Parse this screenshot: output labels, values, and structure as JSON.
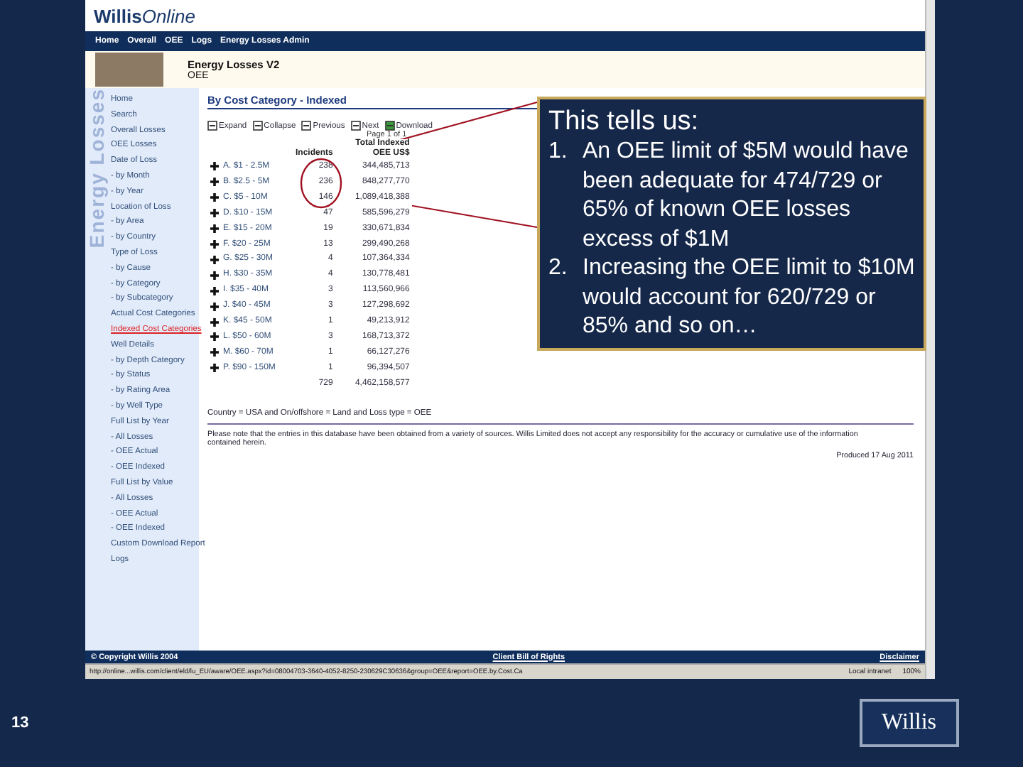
{
  "browser": {
    "logo": {
      "brand": "Willis",
      "suffix": "Online"
    },
    "nav": [
      "Home",
      "Overall",
      "OEE",
      "Logs",
      "Energy Losses Admin"
    ],
    "banner": {
      "title": "Energy Losses V2",
      "subtitle": "OEE"
    },
    "sidebar": {
      "watermark": "Energy Losses",
      "items": [
        {
          "label": "Home",
          "selected": false
        },
        {
          "label": "Search",
          "selected": false
        },
        {
          "label": "Overall Losses",
          "selected": false
        },
        {
          "label": "OEE Losses",
          "selected": false
        },
        {
          "label": "Date of Loss",
          "selected": false
        },
        {
          "label": "- by Month",
          "selected": false
        },
        {
          "label": "- by Year",
          "selected": false
        },
        {
          "label": "Location of Loss",
          "selected": false
        },
        {
          "label": "- by Area",
          "selected": false
        },
        {
          "label": "- by Country",
          "selected": false
        },
        {
          "label": "Type of Loss",
          "selected": false
        },
        {
          "label": "- by Cause",
          "selected": false
        },
        {
          "label": "- by Category",
          "selected": false
        },
        {
          "label": "- by Subcategory",
          "selected": false
        },
        {
          "label": "Actual Cost Categories",
          "selected": false
        },
        {
          "label": "Indexed Cost Categories",
          "selected": true
        },
        {
          "label": "Well Details",
          "selected": false
        },
        {
          "label": "- by Depth Category",
          "selected": false
        },
        {
          "label": "- by Status",
          "selected": false
        },
        {
          "label": "- by Rating Area",
          "selected": false
        },
        {
          "label": "- by Well Type",
          "selected": false
        },
        {
          "label": "Full List by Year",
          "selected": false
        },
        {
          "label": "- All Losses",
          "selected": false
        },
        {
          "label": "- OEE Actual",
          "selected": false
        },
        {
          "label": "- OEE Indexed",
          "selected": false
        },
        {
          "label": "Full List by Value",
          "selected": false
        },
        {
          "label": "- All Losses",
          "selected": false
        },
        {
          "label": "- OEE Actual",
          "selected": false
        },
        {
          "label": "- OEE Indexed",
          "selected": false
        },
        {
          "label": "Custom Download Report",
          "selected": false
        },
        {
          "label": "Logs",
          "selected": false
        }
      ]
    },
    "heading": "By Cost Category - Indexed",
    "toolbar": [
      "Expand",
      "Collapse",
      "Previous",
      "Next",
      "Download"
    ],
    "page_info": "Page 1 of 1",
    "table": {
      "columns": [
        "Incidents",
        "Total Indexed OEE US$"
      ],
      "rows": [
        {
          "category": "A. $1 - 2.5M",
          "incidents": "238",
          "total": "344,485,713"
        },
        {
          "category": "B. $2.5 - 5M",
          "incidents": "236",
          "total": "848,277,770"
        },
        {
          "category": "C. $5 - 10M",
          "incidents": "146",
          "total": "1,089,418,388"
        },
        {
          "category": "D. $10 - 15M",
          "incidents": "47",
          "total": "585,596,279"
        },
        {
          "category": "E. $15 - 20M",
          "incidents": "19",
          "total": "330,671,834"
        },
        {
          "category": "F. $20 - 25M",
          "incidents": "13",
          "total": "299,490,268"
        },
        {
          "category": "G. $25 - 30M",
          "incidents": "4",
          "total": "107,364,334"
        },
        {
          "category": "H. $30 - 35M",
          "incidents": "4",
          "total": "130,778,481"
        },
        {
          "category": "I. $35 - 40M",
          "incidents": "3",
          "total": "113,560,966"
        },
        {
          "category": "J. $40 - 45M",
          "incidents": "3",
          "total": "127,298,692"
        },
        {
          "category": "K. $45 - 50M",
          "incidents": "1",
          "total": "49,213,912"
        },
        {
          "category": "L. $50 - 60M",
          "incidents": "3",
          "total": "168,713,372"
        },
        {
          "category": "M. $60 - 70M",
          "incidents": "1",
          "total": "66,127,276"
        },
        {
          "category": "P. $90 - 150M",
          "incidents": "1",
          "total": "96,394,507"
        }
      ],
      "total": {
        "incidents": "729",
        "total": "4,462,158,577"
      }
    },
    "filter": "Country = USA and On/offshore = Land and Loss type = OEE",
    "note": "Please note that the entries in this database have been obtained from a variety of sources. Willis Limited does not accept any responsibility for the accuracy or cumulative use of the information contained herein.",
    "produced": "Produced 17 Aug 2011",
    "footer": {
      "copyright": "© Copyright Willis 2004",
      "links": [
        "Client Bill of Rights",
        "Disclaimer"
      ]
    },
    "status_bar": {
      "url": "http://online...willis.com/client/eld/lu_EU/aware/OEE.aspx?id=08004703-3640-4052-8250-230629C30636&group=OEE&report=OEE.by.Cost.Ca",
      "zone": "Local intranet",
      "zoom": "100%"
    }
  },
  "callout": {
    "title": "This tells us:",
    "points": [
      {
        "number": "1.",
        "text": "An OEE limit of $5M would have been adequate for 474/729 or 65% of known OEE losses excess of $1M"
      },
      {
        "number": "2.",
        "text": "Increasing the OEE limit to $10M would account for 620/729 or 85% and so on…"
      }
    ]
  },
  "slide": {
    "number": "13",
    "logo": "Willis"
  }
}
